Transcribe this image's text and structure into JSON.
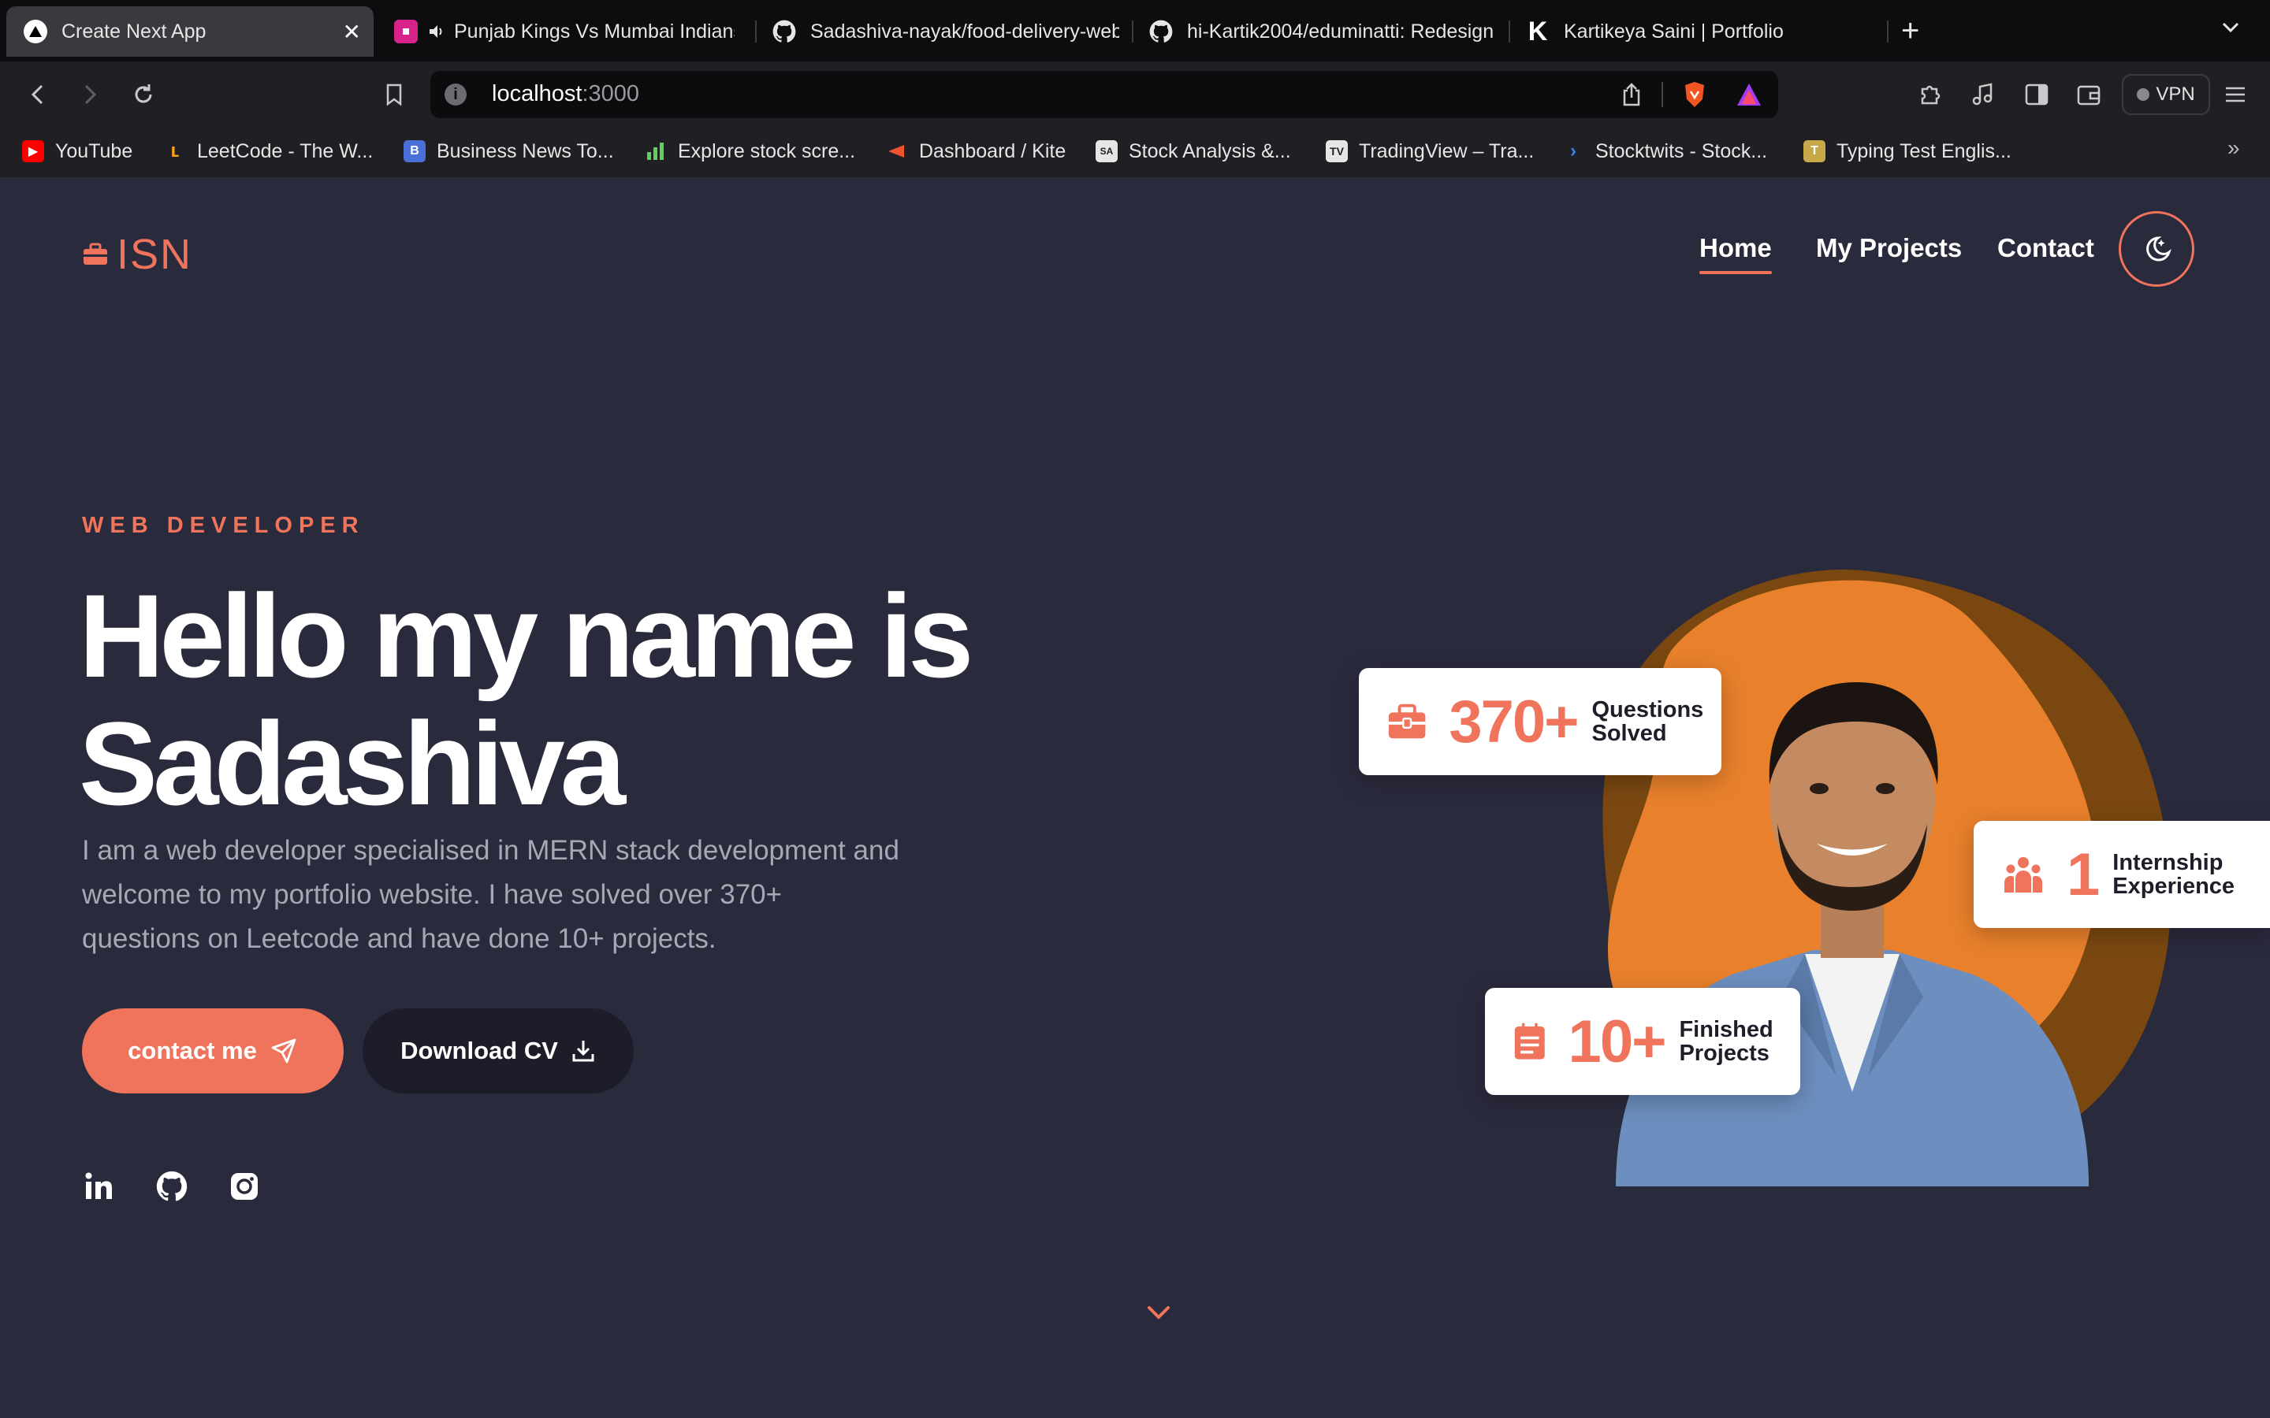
{
  "browser": {
    "tabs": [
      {
        "title": "Create Next App",
        "active": true
      },
      {
        "title": "Punjab Kings Vs Mumbai Indians"
      },
      {
        "title": "Sadashiva-nayak/food-delivery-website"
      },
      {
        "title": "hi-Kartik2004/eduminatti: Redesign"
      },
      {
        "title": "Kartikeya Saini | Portfolio"
      }
    ],
    "url": {
      "host": "localhost",
      "port": ":3000"
    },
    "vpn_label": "VPN",
    "bookmarks": [
      "YouTube",
      "LeetCode - The W...",
      "Business News To...",
      "Explore stock scre...",
      "Dashboard / Kite",
      "Stock Analysis &...",
      "TradingView – Tra...",
      "Stocktwits - Stock...",
      "Typing Test Englis..."
    ]
  },
  "site": {
    "logo_text": "ISN",
    "nav": [
      "Home",
      "My Projects",
      "Contact"
    ],
    "hero": {
      "eyebrow": "WEB DEVELOPER",
      "title_line1": "Hello my name is",
      "title_line2": "Sadashiva",
      "description": "I am a web developer specialised in MERN stack development and welcome to my portfolio website. I have solved over 370+ questions on Leetcode and have done 10+ projects.",
      "contact_button": "contact me",
      "cv_button": "Download CV"
    },
    "stats": [
      {
        "number": "370+",
        "label_line1": "Questions",
        "label_line2": "Solved",
        "icon": "briefcase-icon"
      },
      {
        "number": "1",
        "label_line1": "Internship",
        "label_line2": "Experience",
        "icon": "users-icon"
      },
      {
        "number": "10+",
        "label_line1": "Finished",
        "label_line2": "Projects",
        "icon": "document-icon"
      }
    ],
    "socials": [
      "linkedin-icon",
      "github-icon",
      "instagram-icon"
    ]
  },
  "colors": {
    "accent": "#f0735c",
    "page_bg": "#2a2a3d",
    "blob_orange": "#e9812c",
    "blob_dark": "#7a4710"
  }
}
